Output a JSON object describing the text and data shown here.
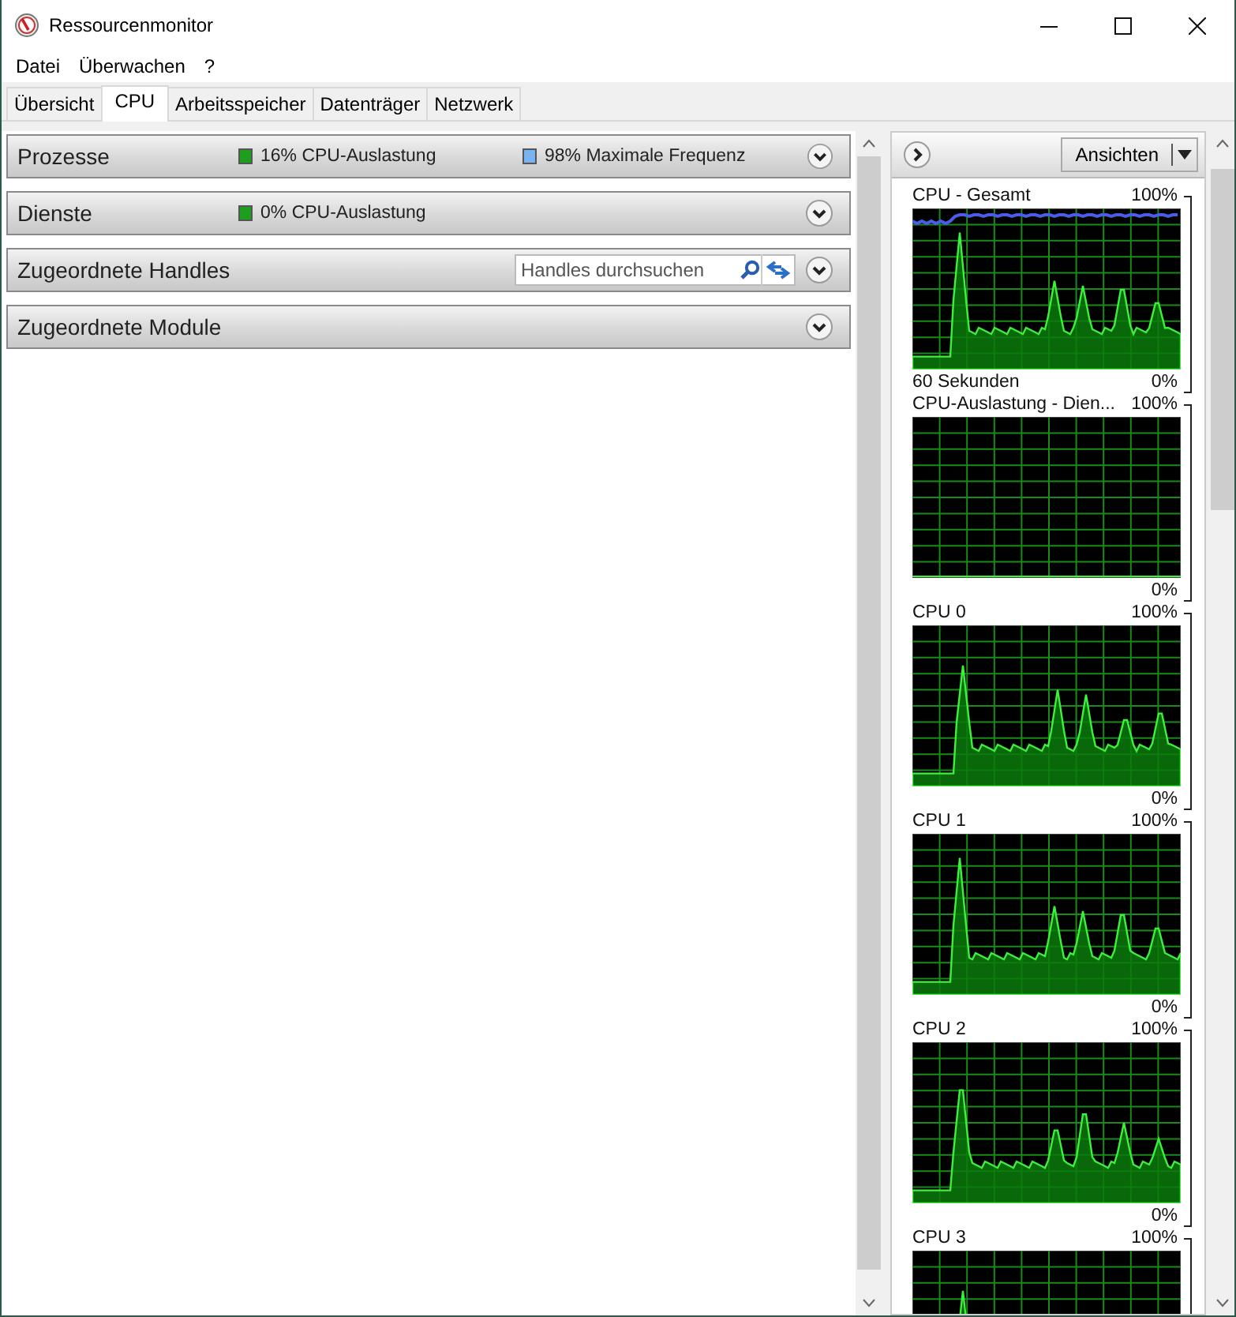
{
  "window": {
    "title": "Ressourcenmonitor"
  },
  "menu": [
    "Datei",
    "Überwachen",
    "?"
  ],
  "tabs": [
    {
      "label": "Übersicht",
      "selected": false
    },
    {
      "label": "CPU",
      "selected": true
    },
    {
      "label": "Arbeitsspeicher",
      "selected": false
    },
    {
      "label": "Datenträger",
      "selected": false
    },
    {
      "label": "Netzwerk",
      "selected": false
    }
  ],
  "sections": [
    {
      "title": "Prozesse",
      "indicators": [
        {
          "text": "16% CPU-Auslastung",
          "color": "#1e9e1e"
        },
        {
          "text": "98% Maximale Frequenz",
          "color": "#78b4f0"
        }
      ]
    },
    {
      "title": "Dienste",
      "indicators": [
        {
          "text": "0% CPU-Auslastung",
          "color": "#1e9e1e"
        }
      ]
    },
    {
      "title": "Zugeordnete Handles",
      "search": {
        "placeholder": "Handles durchsuchen"
      }
    },
    {
      "title": "Zugeordnete Module"
    }
  ],
  "graph_panel": {
    "views_button": "Ansichten",
    "graphs": [
      {
        "kind": "total",
        "title": "CPU - Gesamt",
        "max": "100%",
        "footer": "60 Sekunden",
        "min": "0%"
      },
      {
        "kind": "services",
        "title": "CPU-Auslastung - Dien...",
        "max": "100%",
        "min": "0%"
      },
      {
        "kind": "core",
        "title": "CPU 0",
        "max": "100%",
        "min": "0%"
      },
      {
        "kind": "core",
        "title": "CPU 1",
        "max": "100%",
        "min": "0%"
      },
      {
        "kind": "core",
        "title": "CPU 2",
        "max": "100%",
        "min": "0%"
      },
      {
        "kind": "core",
        "title": "CPU 3",
        "max": "100%"
      }
    ]
  }
}
